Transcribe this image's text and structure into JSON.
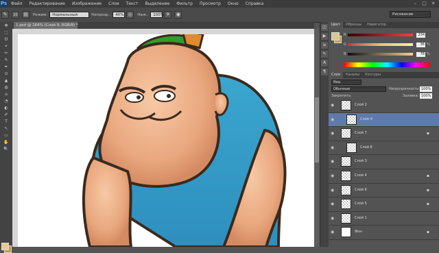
{
  "app": {
    "logo": "Ps"
  },
  "menu": [
    "Файл",
    "Редактирование",
    "Изображение",
    "Слои",
    "Текст",
    "Выделение",
    "Фильтр",
    "Просмотр",
    "Окно",
    "Справка"
  ],
  "window_controls": [
    "–",
    "□",
    "✕"
  ],
  "options": {
    "brush_size": "20",
    "mode_label": "Режим:",
    "mode_value": "Нормальный",
    "opacity_label": "Непрозр.:",
    "opacity_value": "40%",
    "pressure_label": "Наж.:",
    "pressure_value": "100%",
    "workspace": "Рисование"
  },
  "document": {
    "tab_title": "1.psd @ 164% (Слой 9, RGB/8) *"
  },
  "tools": [
    "✥",
    "⬚",
    "ʘ",
    "⌖",
    "✂",
    "✎",
    "✒",
    "⊙",
    "▲",
    "◍",
    "⌂",
    "◔",
    "◐",
    "✐",
    "T",
    "↖",
    "▭",
    "✋",
    "🔍"
  ],
  "color_panel": {
    "tabs": [
      "Цвет",
      "Образцы",
      "Навигатор"
    ],
    "rows": [
      {
        "ch": "R",
        "value": "234",
        "unit": ""
      },
      {
        "ch": "G",
        "value": "36",
        "unit": "%"
      },
      {
        "ch": "B",
        "value": "78",
        "unit": "%"
      }
    ]
  },
  "layers_panel": {
    "tabs": [
      "Слои",
      "Каналы",
      "Контуры"
    ],
    "kind_label": "Вид",
    "blend_mode": "Обычные",
    "opacity_label": "Непрозрачность:",
    "opacity_value": "100%",
    "lock_label": "Закрепить:",
    "fill_label": "Заливка:",
    "fill_value": "100%",
    "layers": [
      {
        "name": "Слой 2",
        "selected": false,
        "indent": false,
        "locked": false
      },
      {
        "name": "Слой 9",
        "selected": true,
        "indent": true,
        "locked": false
      },
      {
        "name": "Слой 7",
        "selected": false,
        "indent": false,
        "locked": true
      },
      {
        "name": "Слой 8",
        "selected": false,
        "indent": true,
        "locked": false
      },
      {
        "name": "Слой 3",
        "selected": false,
        "indent": false,
        "locked": false
      },
      {
        "name": "Слой 4",
        "selected": false,
        "indent": false,
        "locked": true
      },
      {
        "name": "Слой 6",
        "selected": false,
        "indent": false,
        "locked": true
      },
      {
        "name": "Слой 5",
        "selected": false,
        "indent": false,
        "locked": true
      },
      {
        "name": "Слой 1",
        "selected": false,
        "indent": false,
        "locked": false
      },
      {
        "name": "Фон",
        "selected": false,
        "indent": false,
        "locked": true
      }
    ]
  }
}
